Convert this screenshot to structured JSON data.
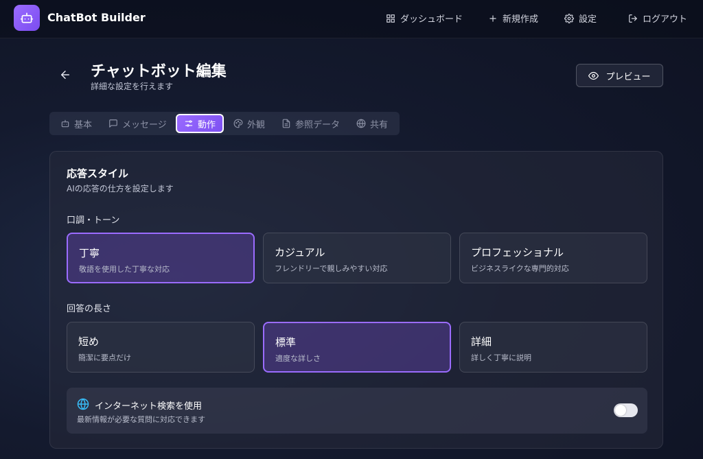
{
  "app": {
    "brand": "ChatBot Builder"
  },
  "nav": {
    "items": [
      {
        "label": "ダッシュボード",
        "icon": "grid-icon"
      },
      {
        "label": "新規作成",
        "icon": "plus-icon"
      },
      {
        "label": "設定",
        "icon": "gear-icon"
      },
      {
        "label": "ログアウト",
        "icon": "logout-icon"
      }
    ]
  },
  "header": {
    "title": "チャットボット編集",
    "subtitle": "詳細な設定を行えます",
    "preview_label": "プレビュー"
  },
  "tabs": [
    {
      "label": "基本",
      "icon": "bot-icon",
      "active": false
    },
    {
      "label": "メッセージ",
      "icon": "message-icon",
      "active": false
    },
    {
      "label": "動作",
      "icon": "sliders-icon",
      "active": true
    },
    {
      "label": "外観",
      "icon": "palette-icon",
      "active": false
    },
    {
      "label": "参照データ",
      "icon": "document-icon",
      "active": false
    },
    {
      "label": "共有",
      "icon": "globe-icon",
      "active": false
    }
  ],
  "response_style": {
    "title": "応答スタイル",
    "subtitle": "AIの応答の仕方を設定します",
    "tone": {
      "label": "口調・トーン",
      "options": [
        {
          "title": "丁寧",
          "desc": "敬語を使用した丁寧な対応",
          "selected": true
        },
        {
          "title": "カジュアル",
          "desc": "フレンドリーで親しみやすい対応",
          "selected": false
        },
        {
          "title": "プロフェッショナル",
          "desc": "ビジネスライクな専門的対応",
          "selected": false
        }
      ]
    },
    "length": {
      "label": "回答の長さ",
      "options": [
        {
          "title": "短め",
          "desc": "簡潔に要点だけ",
          "selected": false
        },
        {
          "title": "標準",
          "desc": "適度な詳しさ",
          "selected": true
        },
        {
          "title": "詳細",
          "desc": "詳しく丁寧に説明",
          "selected": false
        }
      ]
    },
    "internet": {
      "title": "インターネット検索を使用",
      "desc": "最新情報が必要な質問に対応できます",
      "enabled": false
    }
  },
  "colors": {
    "accent": "#9b6cff",
    "accent_dark": "#7d50f2",
    "background": "#141a2e"
  }
}
